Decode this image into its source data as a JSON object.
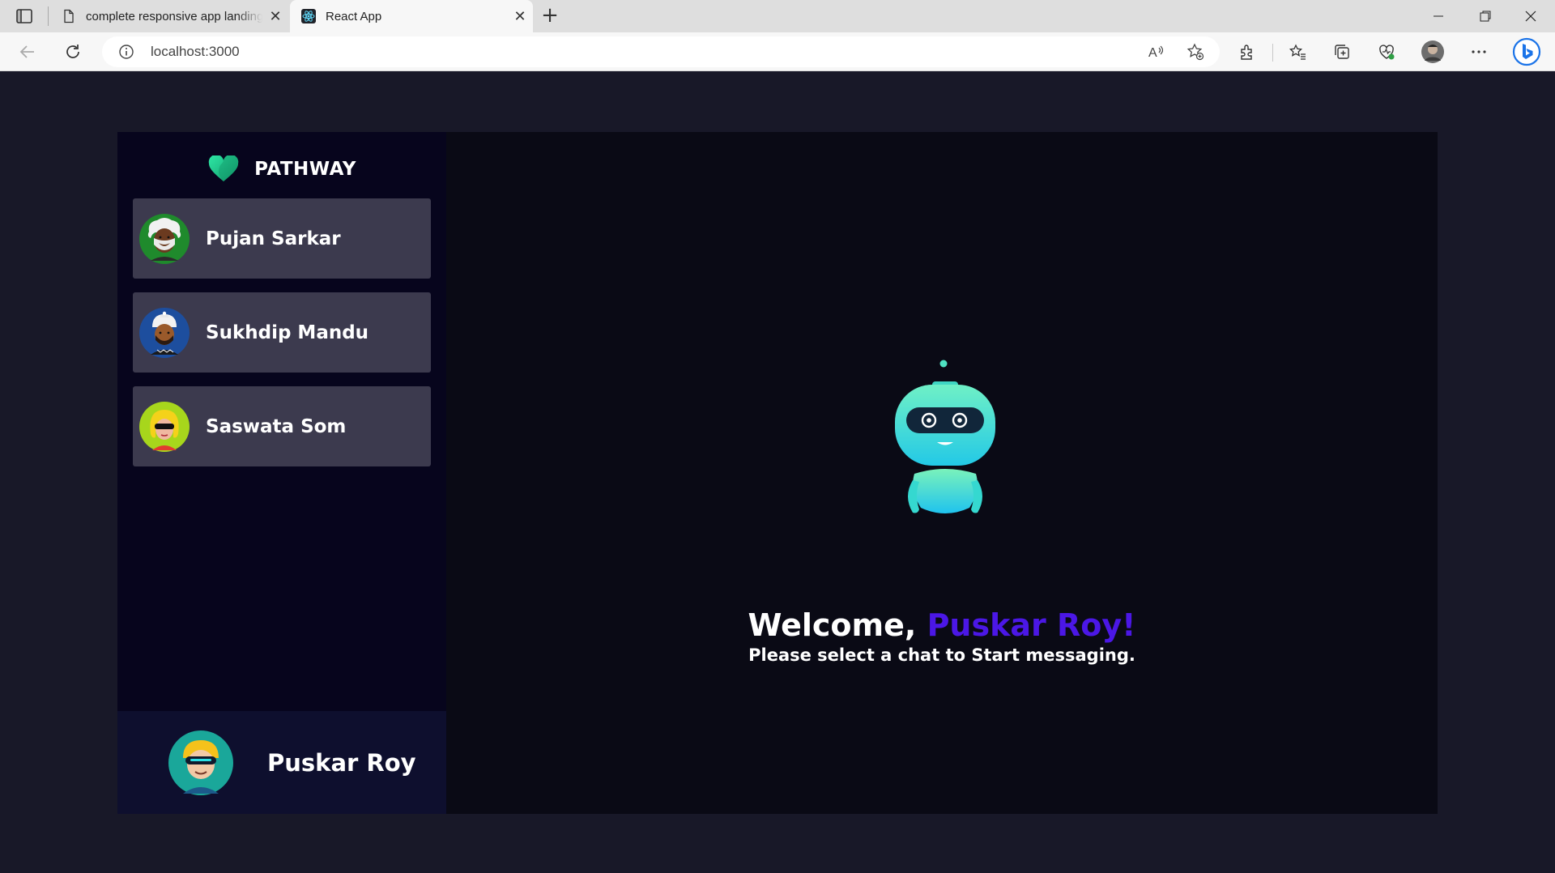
{
  "browser": {
    "tabs": [
      {
        "title": "complete responsive app landing page",
        "active": false
      },
      {
        "title": "React App",
        "active": true
      }
    ],
    "url": "localhost:3000"
  },
  "sidebar": {
    "brand": "PATHWAY",
    "contacts": [
      {
        "name": "Pujan Sarkar",
        "avatar": "avatar-elder-man"
      },
      {
        "name": "Sukhdip Mandu",
        "avatar": "avatar-turban-man"
      },
      {
        "name": "Saswata Som",
        "avatar": "avatar-sunglasses-woman"
      }
    ],
    "current_user": {
      "name": "Puskar Roy",
      "avatar": "avatar-vr-headset-man"
    }
  },
  "welcome": {
    "greeting": "Welcome, ",
    "username": "Puskar Roy!",
    "subtitle": "Please select a chat to Start messaging."
  },
  "colors": {
    "page_bg": "#181828",
    "sidebar_bg": "#07051d",
    "contact_bg": "#3c3a4e",
    "main_bg": "#0a0a15",
    "accent": "#4b17e6"
  }
}
